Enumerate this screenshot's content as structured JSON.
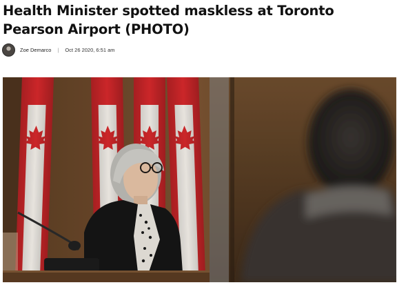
{
  "article": {
    "headline": "Health Minister spotted maskless at Toronto Pearson Airport (PHOTO)",
    "byline": {
      "author": "Zoe Demarco",
      "separator": "|",
      "date": "Oct 26 2020, 6:51 am"
    },
    "photo": {
      "subject": "woman-at-press-conference-with-canadian-flags"
    }
  },
  "colors": {
    "flag_red": "#d6282b",
    "background_wood": "#6b4a2c",
    "blazer": "#151515"
  }
}
